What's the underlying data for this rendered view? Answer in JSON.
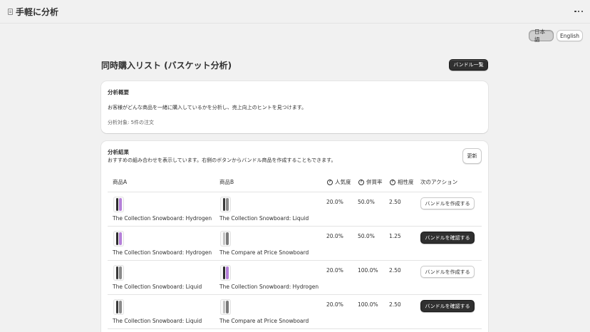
{
  "app": {
    "title": "手軽に分析",
    "icon": "document-icon",
    "menu_icon": "more-horizontal-icon"
  },
  "languages": [
    {
      "label": "日本語",
      "selected": true
    },
    {
      "label": "English",
      "selected": false
    }
  ],
  "page": {
    "title": "同時購入リスト (バスケット分析)",
    "bundle_list_button": "バンドル一覧"
  },
  "overview": {
    "heading": "分析概要",
    "description": "お客様がどんな商品を一緒に購入しているかを分析し、売上向上のヒントを見つけます。",
    "target": "分析対象: 5件の注文"
  },
  "results": {
    "heading": "分析結果",
    "subtitle": "おすすめの組み合わせを表示しています。右側のボタンからバンドル商品を作成することもできます。",
    "refresh_button": "更新",
    "columns": {
      "product_a": "商品A",
      "product_b": "商品B",
      "popularity": "人気度",
      "cobuy_rate": "併買率",
      "affinity": "相性度",
      "next_action": "次のアクション"
    },
    "rows": [
      {
        "product_a": "The Collection Snowboard: Hydrogen",
        "product_b": "The Collection Snowboard: Liquid",
        "popularity": "20.0%",
        "cobuy_rate": "50.0%",
        "affinity": "2.50",
        "action": "バンドルを作成する",
        "action_style": "light"
      },
      {
        "product_a": "The Collection Snowboard: Hydrogen",
        "product_b": "The Compare at Price Snowboard",
        "popularity": "20.0%",
        "cobuy_rate": "50.0%",
        "affinity": "1.25",
        "action": "バンドルを確認する",
        "action_style": "dark"
      },
      {
        "product_a": "The Collection Snowboard: Liquid",
        "product_b": "The Collection Snowboard: Hydrogen",
        "popularity": "20.0%",
        "cobuy_rate": "100.0%",
        "affinity": "2.50",
        "action": "バンドルを作成する",
        "action_style": "light"
      },
      {
        "product_a": "The Collection Snowboard: Liquid",
        "product_b": "The Compare at Price Snowboard",
        "popularity": "20.0%",
        "cobuy_rate": "100.0%",
        "affinity": "2.50",
        "action": "バンドルを確認する",
        "action_style": "dark"
      }
    ]
  },
  "colors": {
    "background": "#f1f1f1",
    "card": "#ffffff",
    "primary_button": "#303030",
    "hydrogen_board": "#b57fd9",
    "liquid_board": "#3a3a3a",
    "compare_board": "#9a9a9a"
  }
}
